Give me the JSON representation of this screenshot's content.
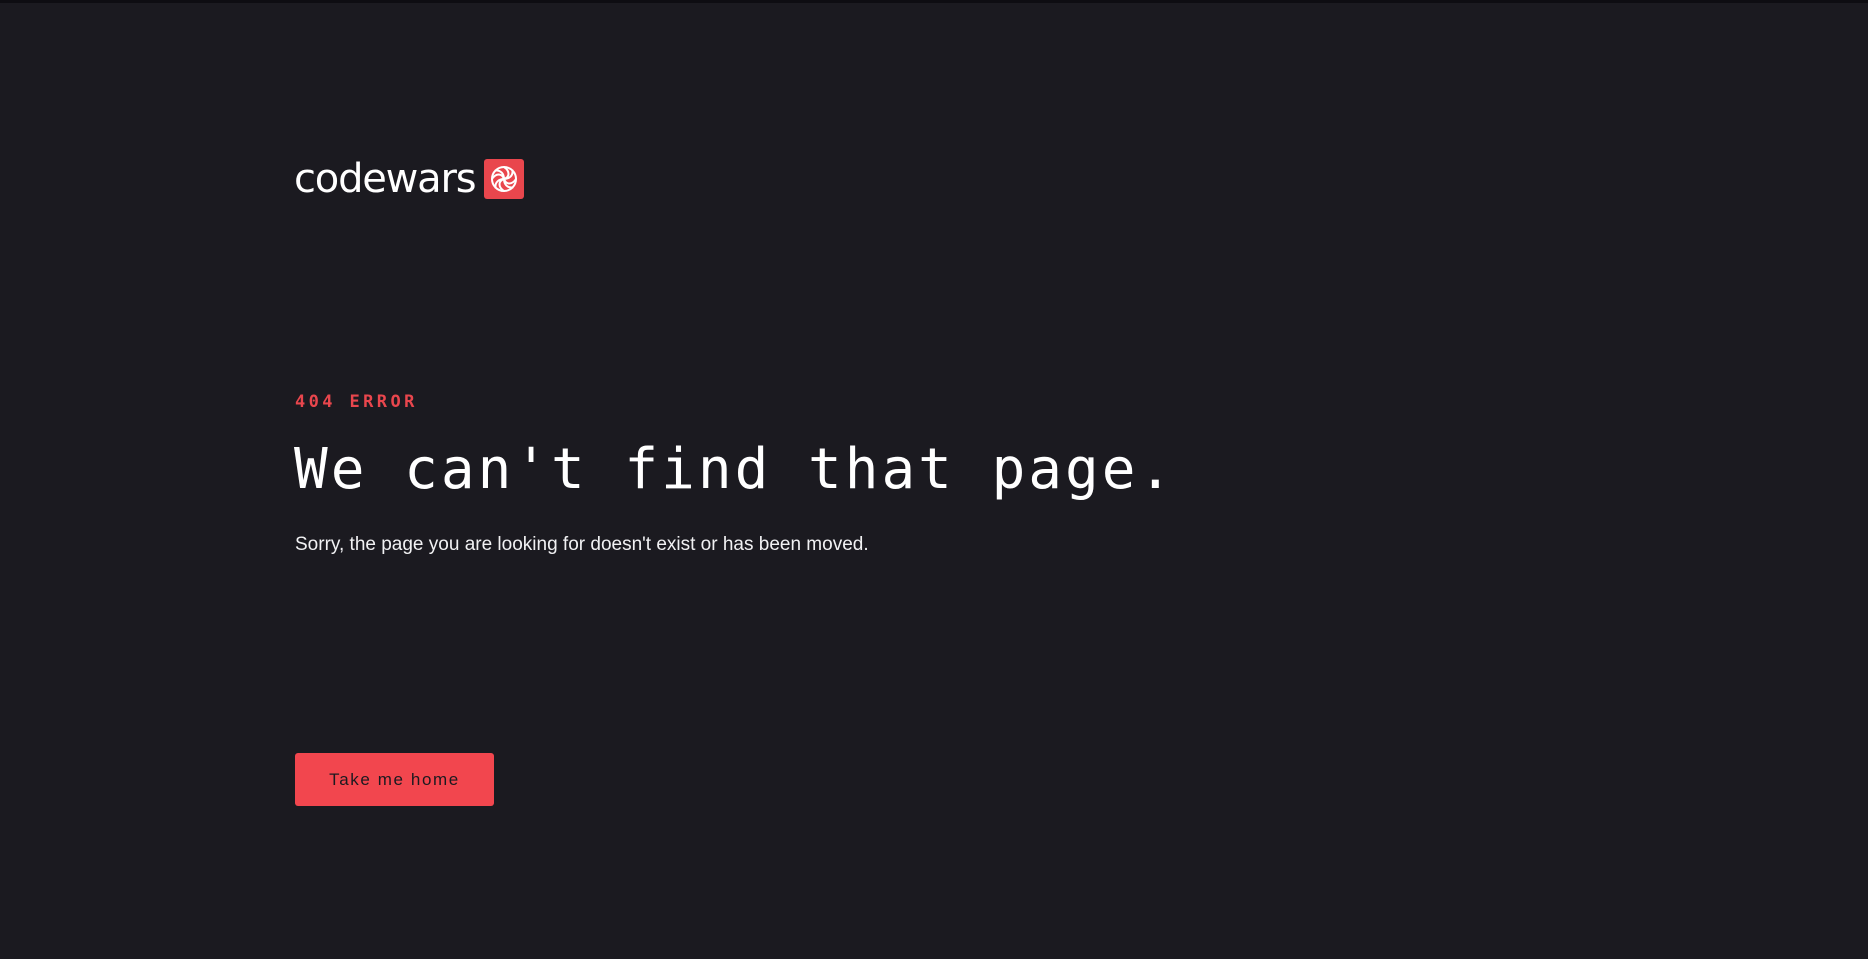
{
  "brand": {
    "name": "codewars",
    "logo_icon": "codewars-swirl-icon",
    "accent_color": "#e9464d"
  },
  "error": {
    "code_label": "404 ERROR",
    "headline": "We can't find that page.",
    "message": "Sorry, the page you are looking for doesn't exist or has been moved."
  },
  "actions": {
    "home_label": "Take me home"
  },
  "colors": {
    "background": "#1b1a20",
    "text": "#ffffff",
    "button": "#f2464e"
  }
}
